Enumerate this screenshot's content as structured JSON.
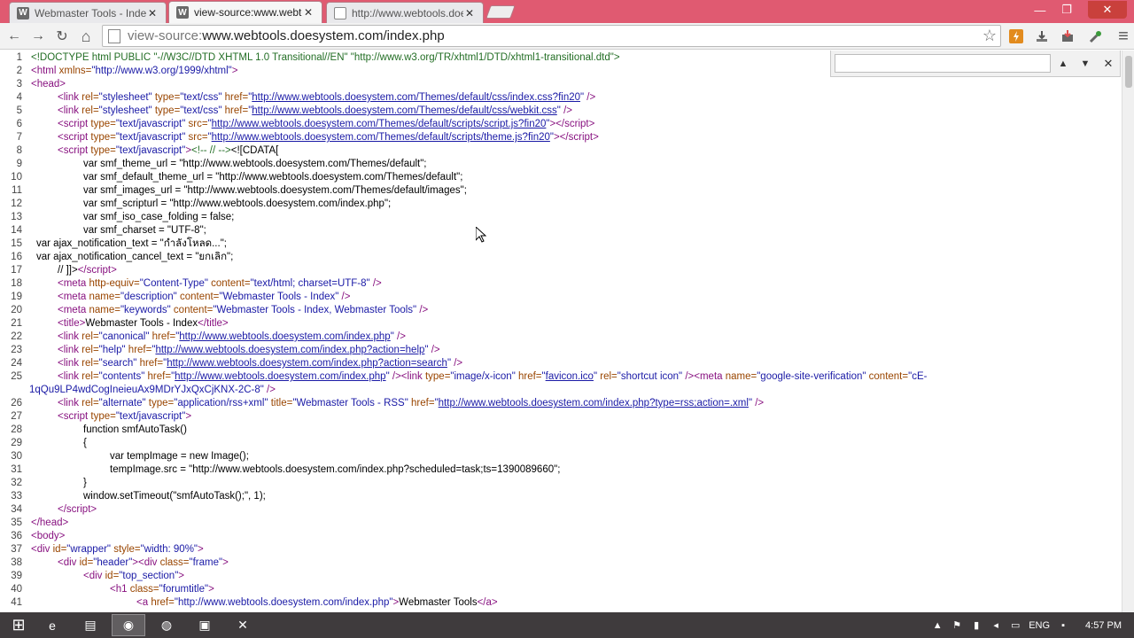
{
  "tabs": [
    {
      "title": "Webmaster Tools - Index",
      "favicon": "W",
      "active": false
    },
    {
      "title": "view-source:www.webtoo",
      "favicon": "W",
      "active": true
    },
    {
      "title": "http://www.webtools.doe",
      "favicon": "page",
      "active": false
    }
  ],
  "window_controls": {
    "minimize": "—",
    "maximize": "❐",
    "close": "✕"
  },
  "toolbar": {
    "back_icon": "←",
    "forward_icon": "→",
    "reload_icon": "↻",
    "home_icon": "⌂",
    "url_prefix": "view-source:",
    "url_host": "www.webtools.doesystem.com/index.php",
    "star_icon": "☆",
    "menu_icon": "≡"
  },
  "findbar": {
    "placeholder": "",
    "prev_icon": "▲",
    "next_icon": "▼",
    "close_icon": "✕"
  },
  "source_lines": [
    {
      "n": "1",
      "indent": 0,
      "html": "<span class=\"cmt\">&lt;!DOCTYPE html PUBLIC \"-//W3C//DTD XHTML 1.0 Transitional//EN\" \"http://www.w3.org/TR/xhtml1/DTD/xhtml1-transitional.dtd\"&gt;</span>"
    },
    {
      "n": "2",
      "indent": 0,
      "html": "<span class=\"tag\">&lt;html </span><span class=\"attr\">xmlns=</span><span class=\"val\">\"http://www.w3.org/1999/xhtml\"</span><span class=\"tag\">&gt;</span>"
    },
    {
      "n": "3",
      "indent": 0,
      "html": "<span class=\"tag\">&lt;head&gt;</span>"
    },
    {
      "n": "4",
      "indent": 30,
      "html": "<span class=\"tag\">&lt;link </span><span class=\"attr\">rel=</span><span class=\"val\">\"stylesheet\"</span> <span class=\"attr\">type=</span><span class=\"val\">\"text/css\"</span> <span class=\"attr\">href=</span><span class=\"val\">\"</span><span class=\"a\">http://www.webtools.doesystem.com/Themes/default/css/index.css?fin20</span><span class=\"val\">\"</span><span class=\"tag\"> /&gt;</span>"
    },
    {
      "n": "5",
      "indent": 30,
      "html": "<span class=\"tag\">&lt;link </span><span class=\"attr\">rel=</span><span class=\"val\">\"stylesheet\"</span> <span class=\"attr\">type=</span><span class=\"val\">\"text/css\"</span> <span class=\"attr\">href=</span><span class=\"val\">\"</span><span class=\"a\">http://www.webtools.doesystem.com/Themes/default/css/webkit.css</span><span class=\"val\">\"</span><span class=\"tag\"> /&gt;</span>"
    },
    {
      "n": "6",
      "indent": 30,
      "html": "<span class=\"tag\">&lt;script </span><span class=\"attr\">type=</span><span class=\"val\">\"text/javascript\"</span> <span class=\"attr\">src=</span><span class=\"val\">\"</span><span class=\"a\">http://www.webtools.doesystem.com/Themes/default/scripts/script.js?fin20</span><span class=\"val\">\"</span><span class=\"tag\">&gt;&lt;/script&gt;</span>"
    },
    {
      "n": "7",
      "indent": 30,
      "html": "<span class=\"tag\">&lt;script </span><span class=\"attr\">type=</span><span class=\"val\">\"text/javascript\"</span> <span class=\"attr\">src=</span><span class=\"val\">\"</span><span class=\"a\">http://www.webtools.doesystem.com/Themes/default/scripts/theme.js?fin20</span><span class=\"val\">\"</span><span class=\"tag\">&gt;&lt;/script&gt;</span>"
    },
    {
      "n": "8",
      "indent": 30,
      "html": "<span class=\"tag\">&lt;script </span><span class=\"attr\">type=</span><span class=\"val\">\"text/javascript\"</span><span class=\"tag\">&gt;</span><span class=\"cmt\">&lt;!-- // --&gt;</span><span class=\"txt\">&lt;![CDATA[</span>"
    },
    {
      "n": "9",
      "indent": 59,
      "html": "<span class=\"txt\">var smf_theme_url = \"http://www.webtools.doesystem.com/Themes/default\";</span>"
    },
    {
      "n": "10",
      "indent": 59,
      "html": "<span class=\"txt\">var smf_default_theme_url = \"http://www.webtools.doesystem.com/Themes/default\";</span>"
    },
    {
      "n": "11",
      "indent": 59,
      "html": "<span class=\"txt\">var smf_images_url = \"http://www.webtools.doesystem.com/Themes/default/images\";</span>"
    },
    {
      "n": "12",
      "indent": 59,
      "html": "<span class=\"txt\">var smf_scripturl = \"http://www.webtools.doesystem.com/index.php\";</span>"
    },
    {
      "n": "13",
      "indent": 59,
      "html": "<span class=\"txt\">var smf_iso_case_folding = false;</span>"
    },
    {
      "n": "14",
      "indent": 59,
      "html": "<span class=\"txt\">var smf_charset = \"UTF-8\";</span>"
    },
    {
      "n": "15",
      "indent": 6,
      "html": "<span class=\"txt\">var ajax_notification_text = \"กำลังโหลด...\";</span>"
    },
    {
      "n": "16",
      "indent": 6,
      "html": "<span class=\"txt\">var ajax_notification_cancel_text = \"ยกเลิก\";</span>"
    },
    {
      "n": "17",
      "indent": 30,
      "html": "<span class=\"txt\">// ]]&gt;</span><span class=\"tag\">&lt;/script&gt;</span>"
    },
    {
      "n": "18",
      "indent": 30,
      "html": "<span class=\"tag\">&lt;meta </span><span class=\"attr\">http-equiv=</span><span class=\"val\">\"Content-Type\"</span> <span class=\"attr\">content=</span><span class=\"val\">\"text/html; charset=UTF-8\"</span><span class=\"tag\"> /&gt;</span>"
    },
    {
      "n": "19",
      "indent": 30,
      "html": "<span class=\"tag\">&lt;meta </span><span class=\"attr\">name=</span><span class=\"val\">\"description\"</span> <span class=\"attr\">content=</span><span class=\"val\">\"Webmaster Tools - Index\"</span><span class=\"tag\"> /&gt;</span>"
    },
    {
      "n": "20",
      "indent": 30,
      "html": "<span class=\"tag\">&lt;meta </span><span class=\"attr\">name=</span><span class=\"val\">\"keywords\"</span> <span class=\"attr\">content=</span><span class=\"val\">\"Webmaster Tools - Index, Webmaster Tools\"</span><span class=\"tag\"> /&gt;</span>"
    },
    {
      "n": "21",
      "indent": 30,
      "html": "<span class=\"tag\">&lt;title&gt;</span><span class=\"txt\">Webmaster Tools - Index</span><span class=\"tag\">&lt;/title&gt;</span>"
    },
    {
      "n": "22",
      "indent": 30,
      "html": "<span class=\"tag\">&lt;link </span><span class=\"attr\">rel=</span><span class=\"val\">\"canonical\"</span> <span class=\"attr\">href=</span><span class=\"val\">\"</span><span class=\"a\">http://www.webtools.doesystem.com/index.php</span><span class=\"val\">\"</span><span class=\"tag\"> /&gt;</span>"
    },
    {
      "n": "23",
      "indent": 30,
      "html": "<span class=\"tag\">&lt;link </span><span class=\"attr\">rel=</span><span class=\"val\">\"help\"</span> <span class=\"attr\">href=</span><span class=\"val\">\"</span><span class=\"a\">http://www.webtools.doesystem.com/index.php?action=help</span><span class=\"val\">\"</span><span class=\"tag\"> /&gt;</span>"
    },
    {
      "n": "24",
      "indent": 30,
      "html": "<span class=\"tag\">&lt;link </span><span class=\"attr\">rel=</span><span class=\"val\">\"search\"</span> <span class=\"attr\">href=</span><span class=\"val\">\"</span><span class=\"a\">http://www.webtools.doesystem.com/index.php?action=search</span><span class=\"val\">\"</span><span class=\"tag\"> /&gt;</span>"
    },
    {
      "n": "25",
      "indent": 30,
      "html": "<span class=\"tag\">&lt;link </span><span class=\"attr\">rel=</span><span class=\"val\">\"contents\"</span> <span class=\"attr\">href=</span><span class=\"val\">\"</span><span class=\"a\">http://www.webtools.doesystem.com/index.php</span><span class=\"val\">\"</span><span class=\"tag\"> /&gt;&lt;link </span><span class=\"attr\">type=</span><span class=\"val\">\"image/x-icon\"</span> <span class=\"attr\">href=</span><span class=\"val\">\"</span><span class=\"a\">favicon.ico</span><span class=\"val\">\"</span> <span class=\"attr\">rel=</span><span class=\"val\">\"shortcut icon\"</span><span class=\"tag\"> /&gt;&lt;meta </span><span class=\"attr\">name=</span><span class=\"val\">\"google-site-verification\"</span> <span class=\"attr\">content=</span><span class=\"val\">\"cE-</span>"
    },
    {
      "n": "",
      "indent": -1,
      "html": "<span class=\"val\">1qQu9LP4wdCogIneieuAx9MDrYJxQxCjKNX-2C-8\"</span><span class=\"tag\"> /&gt;</span>"
    },
    {
      "n": "26",
      "indent": 30,
      "html": "<span class=\"tag\">&lt;link </span><span class=\"attr\">rel=</span><span class=\"val\">\"alternate\"</span> <span class=\"attr\">type=</span><span class=\"val\">\"application/rss+xml\"</span> <span class=\"attr\">title=</span><span class=\"val\">\"Webmaster Tools - RSS\"</span> <span class=\"attr\">href=</span><span class=\"val\">\"</span><span class=\"a\">http://www.webtools.doesystem.com/index.php?type=rss;action=.xml</span><span class=\"val\">\"</span><span class=\"tag\"> /&gt;</span>"
    },
    {
      "n": "27",
      "indent": 30,
      "html": "<span class=\"tag\">&lt;script </span><span class=\"attr\">type=</span><span class=\"val\">\"text/javascript\"</span><span class=\"tag\">&gt;</span>"
    },
    {
      "n": "28",
      "indent": 59,
      "html": "<span class=\"txt\">function smfAutoTask()</span>"
    },
    {
      "n": "29",
      "indent": 59,
      "html": "<span class=\"txt\">{</span>"
    },
    {
      "n": "30",
      "indent": 89,
      "html": "<span class=\"txt\">var tempImage = new Image();</span>"
    },
    {
      "n": "31",
      "indent": 89,
      "html": "<span class=\"txt\">tempImage.src = \"http://www.webtools.doesystem.com/index.php?scheduled=task;ts=1390089660\";</span>"
    },
    {
      "n": "32",
      "indent": 59,
      "html": "<span class=\"txt\">}</span>"
    },
    {
      "n": "33",
      "indent": 59,
      "html": "<span class=\"txt\">window.setTimeout(\"smfAutoTask();\", 1);</span>"
    },
    {
      "n": "34",
      "indent": 30,
      "html": "<span class=\"tag\">&lt;/script&gt;</span>"
    },
    {
      "n": "35",
      "indent": 0,
      "html": "<span class=\"tag\">&lt;/head&gt;</span>"
    },
    {
      "n": "36",
      "indent": 0,
      "html": "<span class=\"tag\">&lt;body&gt;</span>"
    },
    {
      "n": "37",
      "indent": 0,
      "html": "<span class=\"tag\">&lt;div </span><span class=\"attr\">id=</span><span class=\"val\">\"wrapper\"</span> <span class=\"attr\">style=</span><span class=\"val\">\"width: 90%\"</span><span class=\"tag\">&gt;</span>"
    },
    {
      "n": "38",
      "indent": 30,
      "html": "<span class=\"tag\">&lt;div </span><span class=\"attr\">id=</span><span class=\"val\">\"header\"</span><span class=\"tag\">&gt;&lt;div </span><span class=\"attr\">class=</span><span class=\"val\">\"frame\"</span><span class=\"tag\">&gt;</span>"
    },
    {
      "n": "39",
      "indent": 59,
      "html": "<span class=\"tag\">&lt;div </span><span class=\"attr\">id=</span><span class=\"val\">\"top_section\"</span><span class=\"tag\">&gt;</span>"
    },
    {
      "n": "40",
      "indent": 89,
      "html": "<span class=\"tag\">&lt;h1 </span><span class=\"attr\">class=</span><span class=\"val\">\"forumtitle\"</span><span class=\"tag\">&gt;</span>"
    },
    {
      "n": "41",
      "indent": 119,
      "html": "<span class=\"tag\">&lt;a </span><span class=\"attr\">href=</span><span class=\"val\">\"http://www.webtools.doesystem.com/index.php\"</span><span class=\"tag\">&gt;</span><span class=\"txt\">Webmaster Tools</span><span class=\"tag\">&lt;/a&gt;</span>"
    }
  ],
  "taskbar": {
    "start_icon": "⊞",
    "apps": [
      {
        "name": "internet-explorer-icon",
        "glyph": "e"
      },
      {
        "name": "file-explorer-icon",
        "glyph": "▤"
      },
      {
        "name": "chrome-icon",
        "glyph": "◉"
      },
      {
        "name": "firefox-icon",
        "glyph": "◍"
      },
      {
        "name": "terminal-icon",
        "glyph": "▣"
      },
      {
        "name": "app-icon",
        "glyph": "✕"
      }
    ],
    "language": "ENG",
    "clock": "4:57 PM"
  }
}
